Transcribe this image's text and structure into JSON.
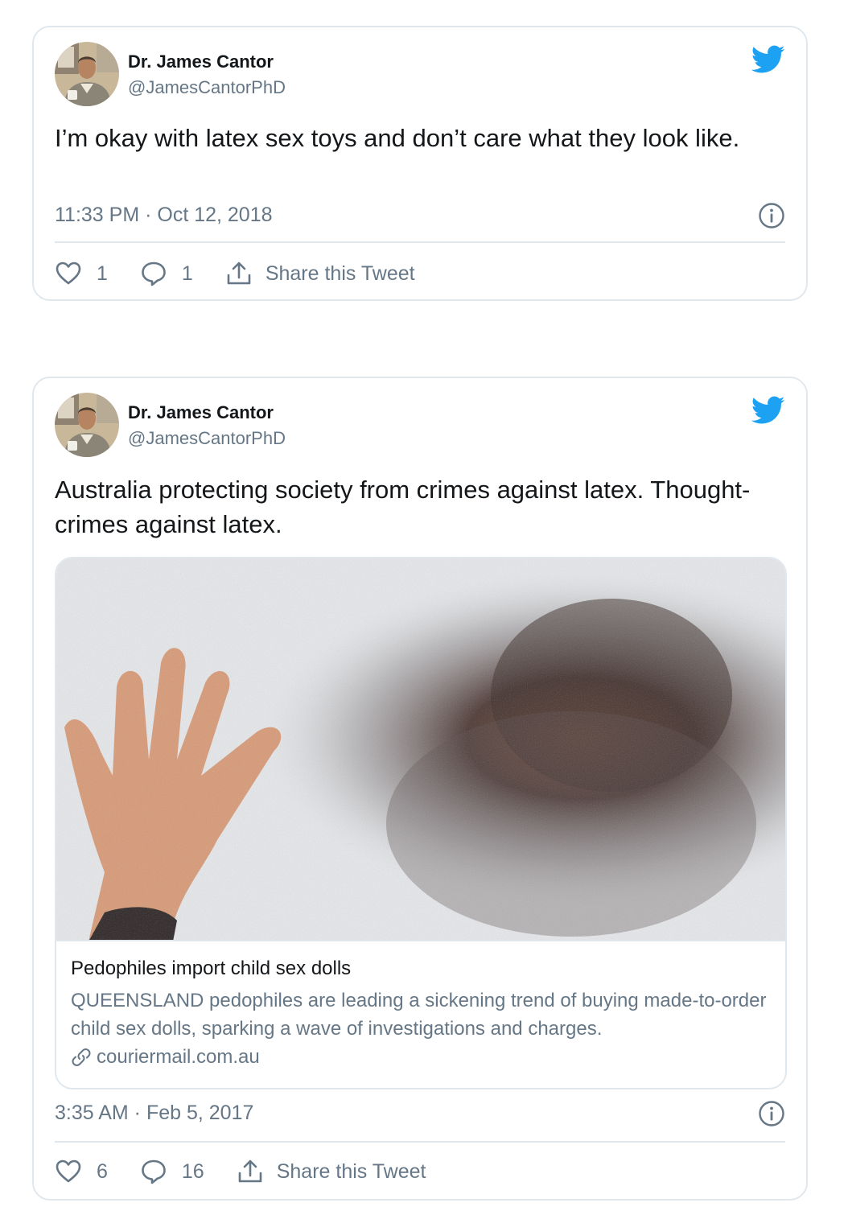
{
  "colors": {
    "twitter_blue": "#1da1f2",
    "text_secondary": "#657786",
    "border": "#e1e8ed"
  },
  "tweets": [
    {
      "author": {
        "name": "Dr. James Cantor",
        "handle": "@JamesCantorPhD"
      },
      "text": "I’m okay with latex sex toys and don’t care what they look like.",
      "timestamp": "11:33 PM · Oct 12, 2018",
      "likes": "1",
      "replies": "1",
      "share_label": "Share this Tweet",
      "icons": [
        "twitter-bird-icon",
        "info-icon",
        "heart-icon",
        "reply-icon",
        "share-icon"
      ]
    },
    {
      "author": {
        "name": "Dr. James Cantor",
        "handle": "@JamesCantorPhD"
      },
      "text": "Australia protecting society from crimes against latex. Thought-crimes against latex.",
      "link_card": {
        "title": "Pedophiles import child sex dolls",
        "description": "QUEENSLAND pedophiles are leading a sickening trend of buying made-to-order child sex dolls, sparking a wave of investigations and charges.",
        "domain": "couriermail.com.au"
      },
      "timestamp": "3:35 AM · Feb 5, 2017",
      "likes": "6",
      "replies": "16",
      "share_label": "Share this Tweet",
      "icons": [
        "twitter-bird-icon",
        "info-icon",
        "heart-icon",
        "reply-icon",
        "share-icon",
        "link-icon"
      ]
    }
  ]
}
